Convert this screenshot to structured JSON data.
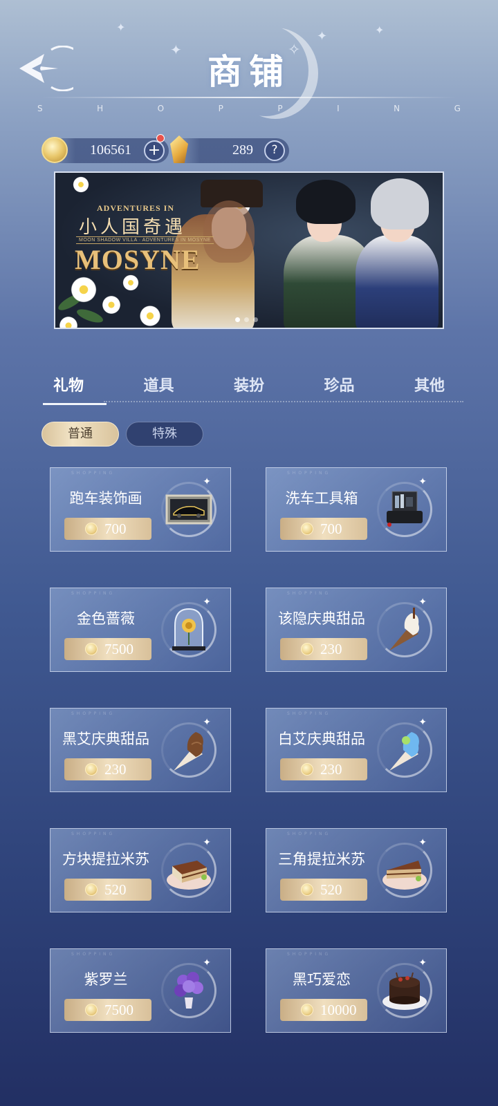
{
  "header": {
    "title": "商铺",
    "subtitle": [
      "S",
      "H",
      "O",
      "P",
      "P",
      "I",
      "N",
      "G"
    ]
  },
  "currency": {
    "gold": "106561",
    "gems": "289",
    "add_symbol": "+",
    "help_symbol": "?"
  },
  "banner": {
    "small_title": "ADVENTURES IN",
    "cn_title": "小人国奇遇",
    "tagline": "MOON SHADOW VILLA · ADVENTURES IN MOSYNE",
    "big_title": "MOSYNE"
  },
  "tabs": [
    "礼物",
    "道具",
    "装扮",
    "珍品",
    "其他"
  ],
  "subtabs": [
    "普通",
    "特殊"
  ],
  "items": [
    {
      "name": "跑车装饰画",
      "price": "700",
      "icon": "car-painting-icon"
    },
    {
      "name": "洗车工具箱",
      "price": "700",
      "icon": "toolbox-icon"
    },
    {
      "name": "金色蔷薇",
      "price": "7500",
      "icon": "golden-rose-icon"
    },
    {
      "name": "该隐庆典甜品",
      "price": "230",
      "icon": "vanilla-ice-cream-icon"
    },
    {
      "name": "黑艾庆典甜品",
      "price": "230",
      "icon": "chocolate-ice-cream-icon"
    },
    {
      "name": "白艾庆典甜品",
      "price": "230",
      "icon": "blue-ice-cream-icon"
    },
    {
      "name": "方块提拉米苏",
      "price": "520",
      "icon": "square-tiramisu-icon"
    },
    {
      "name": "三角提拉米苏",
      "price": "520",
      "icon": "triangle-tiramisu-icon"
    },
    {
      "name": "紫罗兰",
      "price": "7500",
      "icon": "violet-flower-icon"
    },
    {
      "name": "黑巧爱恋",
      "price": "10000",
      "icon": "chocolate-cake-icon"
    }
  ],
  "colors": {
    "accent_gold": "#e8c669",
    "price_tag": "#e3cda8",
    "card_border": "#e1e8f8"
  }
}
